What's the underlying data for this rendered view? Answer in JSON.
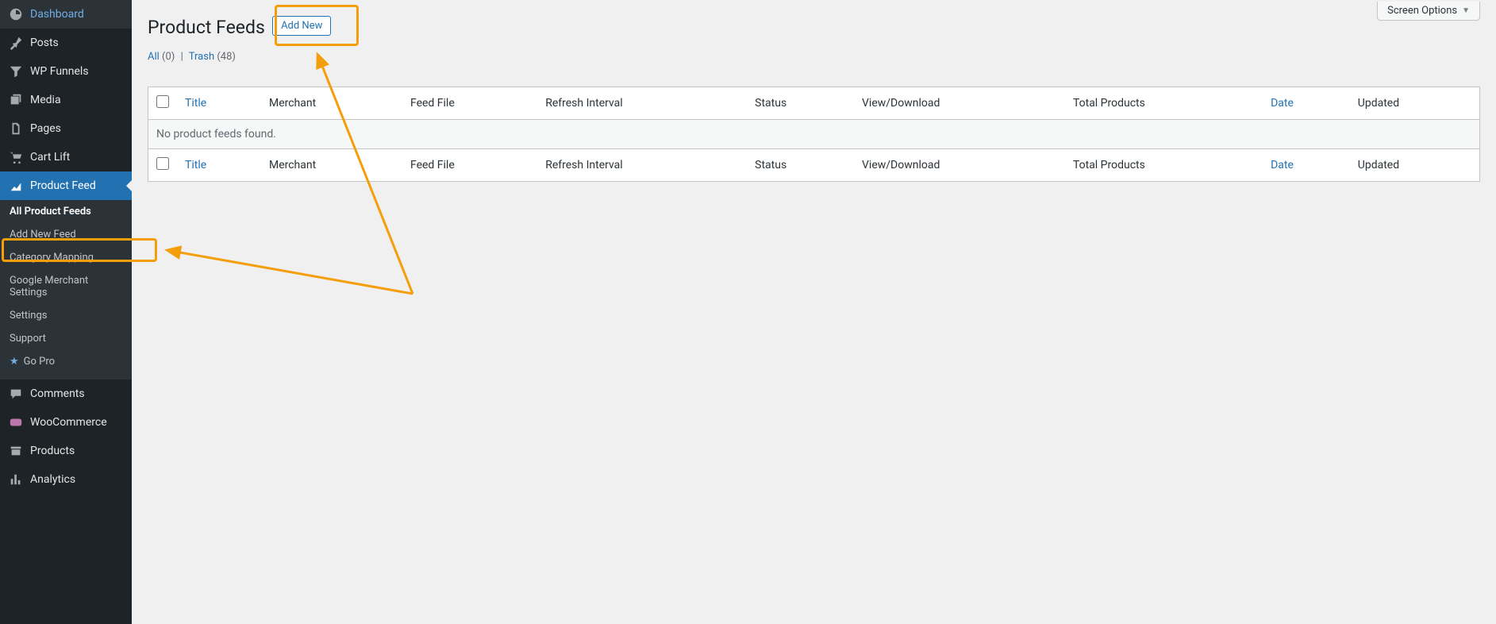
{
  "sidebar": {
    "items": [
      {
        "label": "Dashboard",
        "icon": "dashboard-icon"
      },
      {
        "label": "Posts",
        "icon": "pin-icon"
      },
      {
        "label": "WP Funnels",
        "icon": "funnel-icon"
      },
      {
        "label": "Media",
        "icon": "media-icon"
      },
      {
        "label": "Pages",
        "icon": "pages-icon"
      },
      {
        "label": "Cart Lift",
        "icon": "cart-icon"
      },
      {
        "label": "Product Feed",
        "icon": "chart-icon",
        "active": true
      },
      {
        "label": "Comments",
        "icon": "comment-icon"
      },
      {
        "label": "WooCommerce",
        "icon": "woo-icon"
      },
      {
        "label": "Products",
        "icon": "archive-icon"
      },
      {
        "label": "Analytics",
        "icon": "bars-icon"
      }
    ],
    "sub": [
      {
        "label": "All Product Feeds",
        "current": true
      },
      {
        "label": "Add New Feed"
      },
      {
        "label": "Category Mapping"
      },
      {
        "label": "Google Merchant Settings"
      },
      {
        "label": "Settings"
      },
      {
        "label": "Support"
      },
      {
        "label": "Go Pro",
        "star": true
      }
    ]
  },
  "screen_options_label": "Screen Options",
  "page_title": "Product Feeds",
  "add_new_label": "Add New",
  "filters": {
    "all_label": "All",
    "all_count": "(0)",
    "trash_label": "Trash",
    "trash_count": "(48)"
  },
  "table": {
    "columns": {
      "title": "Title",
      "merchant": "Merchant",
      "feed_file": "Feed File",
      "refresh": "Refresh Interval",
      "status": "Status",
      "viewdl": "View/Download",
      "total": "Total Products",
      "date": "Date",
      "updated": "Updated"
    },
    "empty_text": "No product feeds found."
  }
}
